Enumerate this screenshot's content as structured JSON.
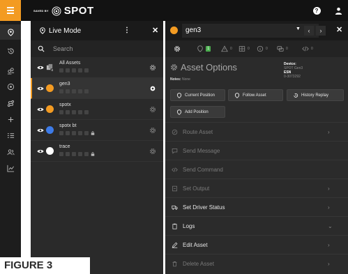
{
  "app": {
    "brand_small": "SAVED BY",
    "brand": "SPOT",
    "accent_color": "#f39b22",
    "help_icon": "help-circle-icon",
    "user_icon": "user-icon"
  },
  "rail": {
    "items": [
      {
        "icon": "location-pin-icon",
        "active": true
      },
      {
        "icon": "history-icon"
      },
      {
        "icon": "users-group-icon"
      },
      {
        "icon": "target-icon"
      },
      {
        "icon": "route-icon"
      },
      {
        "icon": "plus-icon"
      },
      {
        "icon": "checklist-icon"
      },
      {
        "icon": "people-icon"
      },
      {
        "icon": "chart-icon"
      }
    ]
  },
  "list": {
    "mode_label": "Live Mode",
    "menu_glyph": "⋮",
    "close_glyph": "✕",
    "search_placeholder": "Search",
    "assets": [
      {
        "name": "All Assets",
        "icon": "asset-group-icon",
        "badge": "4"
      },
      {
        "name": "gen3",
        "icon": "tracker-icon",
        "color": "#f39b22",
        "selected": true
      },
      {
        "name": "spotx",
        "icon": "tracker-icon",
        "color": "#f39b22"
      },
      {
        "name": "spotx bt",
        "icon": "tracker-icon",
        "color": "#3d7be8"
      },
      {
        "name": "trace",
        "icon": "tracker-icon",
        "color": "#ffffff"
      }
    ]
  },
  "detail": {
    "asset_name": "gen3",
    "caret": "▼",
    "prev": "‹",
    "next": "›",
    "close_glyph": "✕",
    "tabs": [
      {
        "icon": "settings-icon",
        "count": ""
      },
      {
        "icon": "pin-icon",
        "count": "1"
      },
      {
        "icon": "alert-icon",
        "count": "0"
      },
      {
        "icon": "table-icon",
        "count": "0"
      },
      {
        "icon": "info-icon",
        "count": "0"
      },
      {
        "icon": "message-icon",
        "count": "0"
      },
      {
        "icon": "code-icon",
        "count": "0"
      }
    ],
    "title": "Asset Options",
    "notes_label": "Notes:",
    "notes_value": "None",
    "device_label": "Device:",
    "device_value": "SPOT Gen3",
    "esn_label": "ESN",
    "esn_value": "0-3073292",
    "buttons": {
      "current_position": "Current Position",
      "follow_asset": "Follow Asset",
      "history_replay": "History Replay",
      "add_position": "Add Position"
    },
    "menu": [
      {
        "label": "Route Asset",
        "icon": "route-icon",
        "disabled": true,
        "chevron": "›"
      },
      {
        "label": "Send Message",
        "icon": "message-icon",
        "disabled": true,
        "chevron": ""
      },
      {
        "label": "Send Command",
        "icon": "code-icon",
        "disabled": true,
        "chevron": ""
      },
      {
        "label": "Set Output",
        "icon": "output-icon",
        "disabled": true,
        "chevron": "›"
      },
      {
        "label": "Set Driver Status",
        "icon": "truck-icon",
        "disabled": false,
        "chevron": "›"
      },
      {
        "label": "Logs",
        "icon": "clipboard-icon",
        "disabled": false,
        "chevron": "⌄"
      },
      {
        "label": "Edit Asset",
        "icon": "edit-icon",
        "disabled": false,
        "chevron": "›"
      },
      {
        "label": "Delete Asset",
        "icon": "trash-icon",
        "disabled": true,
        "chevron": "›"
      }
    ]
  },
  "figure_label": "FIGURE 3"
}
